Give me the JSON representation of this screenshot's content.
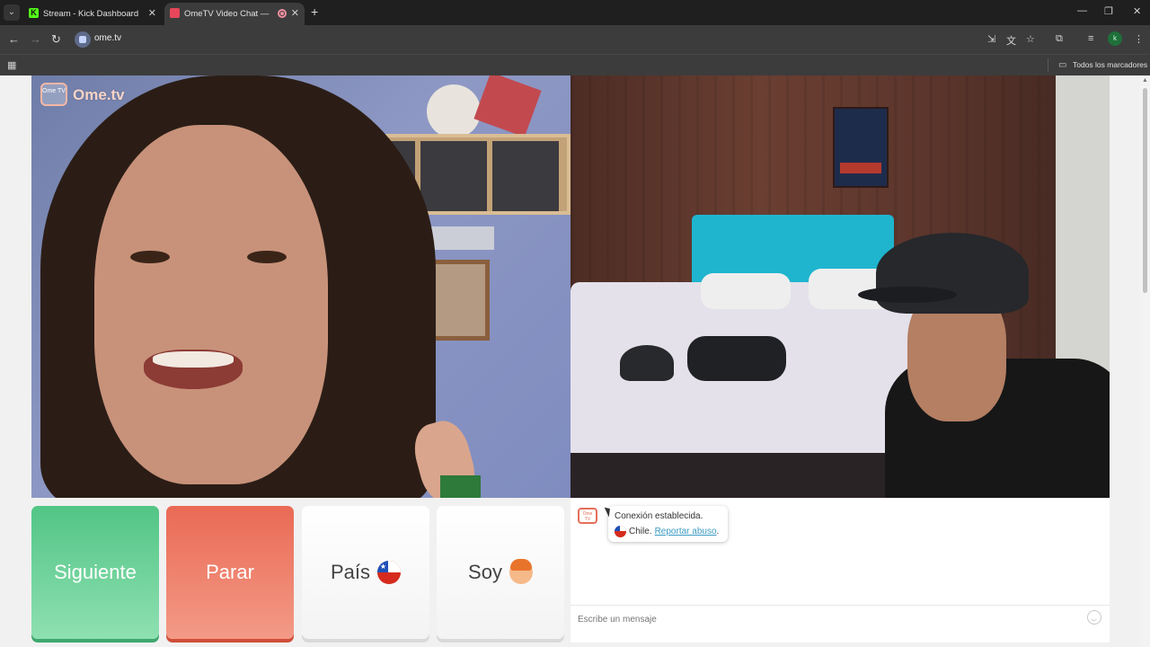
{
  "browser": {
    "tabs": [
      {
        "title": "Stream - Kick Dashboard",
        "favicon": "kick-icon"
      },
      {
        "title": "OmeTV Video Chat — Ome",
        "favicon": "ometv-icon",
        "active": true
      }
    ],
    "url": "ome.tv",
    "bookmarks_folder_label": "Todos los marcadores",
    "profile_initial": "k"
  },
  "video": {
    "logo_small": "Ome TV",
    "logo_text": "Ome.tv"
  },
  "controls": {
    "next_label": "Siguiente",
    "stop_label": "Parar",
    "country_label": "País",
    "gender_label": "Soy"
  },
  "chat": {
    "logo_text": "Ome TV",
    "status_line": "Conexión establecida.",
    "country": "Chile.",
    "report_link": "Reportar abuso",
    "report_suffix": ".",
    "input_placeholder": "Escribe un mensaje"
  },
  "colors": {
    "next_button": "#52c585",
    "stop_button": "#ea6a55",
    "link": "#3b9ac2"
  }
}
